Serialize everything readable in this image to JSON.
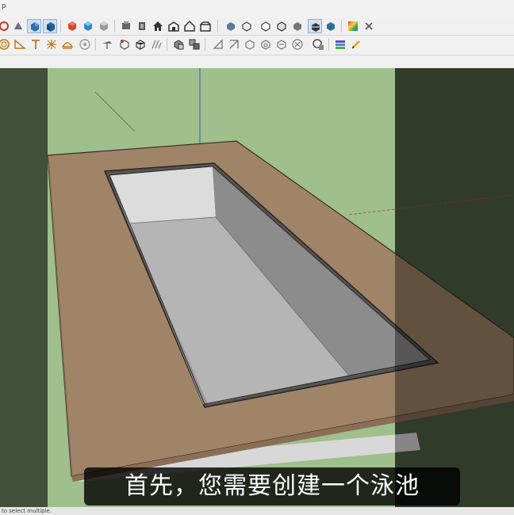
{
  "menubar": {
    "text": "p"
  },
  "status": {
    "text": "to select multiple."
  },
  "subtitle": {
    "text": "首先，您需要创建一个泳池"
  },
  "colors": {
    "viewport_green": "#9fbf8c",
    "dark_overlay": "#4d5f42",
    "wood": "#a08468",
    "pool_floor": "#b8b8b8",
    "pool_wall": "#8a8a8a"
  },
  "toolbar_icons": {
    "row1": [
      "orbit-icon",
      "pan-icon",
      "zoom-icon",
      "zoom-extents-icon",
      "red-box-icon",
      "blue-box-icon",
      "gray-box-icon",
      "views-icon",
      "iso-view-icon",
      "home-icon",
      "front-view-icon",
      "house-outline-icon",
      "right-view-icon",
      "style-xray-icon",
      "style-wireframe-icon",
      "style-hidden-line-icon",
      "style-shaded-icon",
      "style-textured-icon",
      "style-monochrome-icon",
      "material-icon",
      "color-palette-icon",
      "dismiss-icon"
    ],
    "row2": [
      "circle-icon",
      "protractor-icon",
      "text-icon",
      "axes-icon",
      "dimension-icon",
      "section-plane-icon",
      "paint-icon",
      "push-pull-icon",
      "move-icon",
      "rotate-icon",
      "scale-icon",
      "components-icon",
      "group-icon",
      "solid-tools-icon",
      "outer-shell-icon",
      "intersect-icon",
      "union-icon",
      "subtract-icon",
      "trim-icon",
      "split-icon",
      "layers-icon",
      "pencil-icon"
    ]
  }
}
